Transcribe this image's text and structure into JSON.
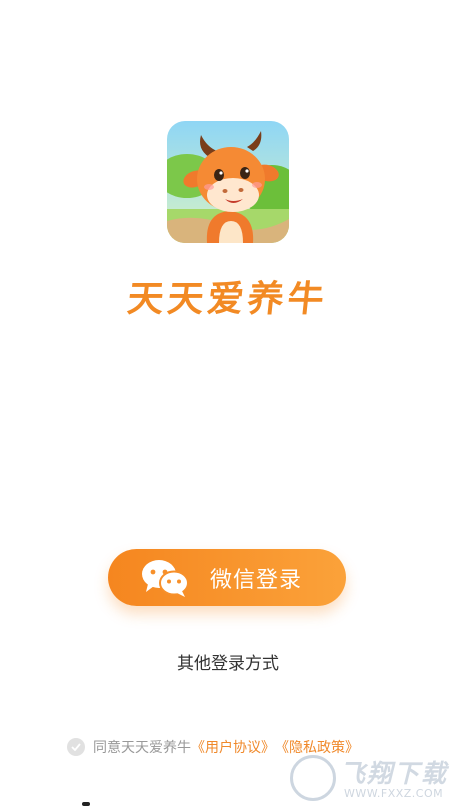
{
  "app": {
    "name": "天天爱养牛",
    "icon": "cow-mascot-logo"
  },
  "login": {
    "wechat_label": "微信登录",
    "wechat_icon": "wechat-icon",
    "other_label": "其他登录方式"
  },
  "agreement": {
    "prefix": "同意天天爱养牛",
    "user_agreement": "《用户协议》",
    "privacy_policy": "《隐私政策》"
  },
  "watermark": {
    "title": "飞翔下载",
    "url": "WWW.FXXZ.COM"
  },
  "colors": {
    "accent": "#f28a24",
    "button_start": "#f5861f",
    "button_end": "#fba23a",
    "link": "#f0892a",
    "muted_text": "#999999"
  }
}
